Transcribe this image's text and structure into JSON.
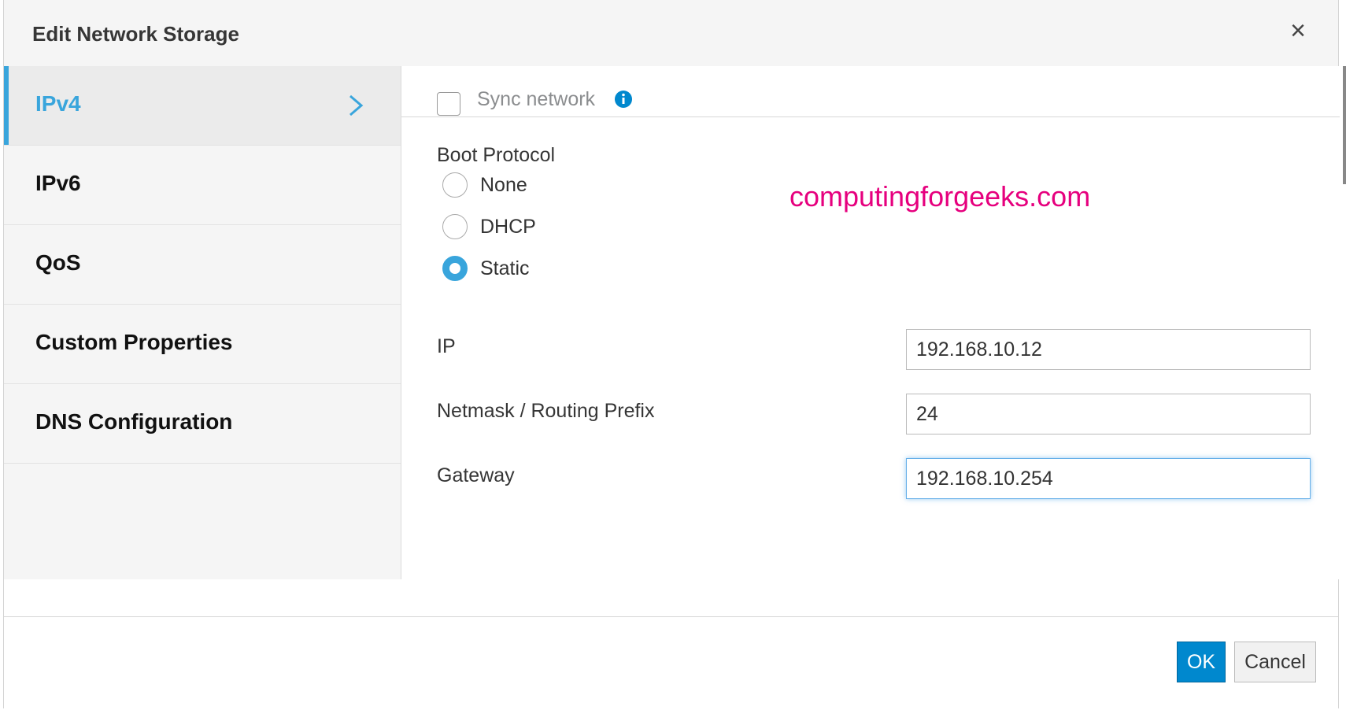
{
  "dialog": {
    "title": "Edit Network Storage",
    "close_glyph": "×"
  },
  "sidebar": {
    "items": [
      {
        "label": "IPv4",
        "active": true
      },
      {
        "label": "IPv6",
        "active": false
      },
      {
        "label": "QoS",
        "active": false
      },
      {
        "label": "Custom Properties",
        "active": false
      },
      {
        "label": "DNS Configuration",
        "active": false
      }
    ]
  },
  "content": {
    "sync_network": {
      "label": "Sync network",
      "checked": false,
      "icon": "info-icon"
    },
    "boot_protocol": {
      "label": "Boot Protocol",
      "options": [
        {
          "label": "None",
          "selected": false
        },
        {
          "label": "DHCP",
          "selected": false
        },
        {
          "label": "Static",
          "selected": true
        }
      ]
    },
    "ip": {
      "label": "IP",
      "value": "192.168.10.12"
    },
    "netmask": {
      "label": "Netmask / Routing Prefix",
      "value": "24"
    },
    "gateway": {
      "label": "Gateway",
      "value": "192.168.10.254"
    },
    "watermark": "computingforgeeks.com"
  },
  "footer": {
    "ok_label": "OK",
    "cancel_label": "Cancel"
  },
  "colors": {
    "accent": "#39a5dc",
    "primary_button": "#0088ce",
    "watermark": "#e6007e"
  }
}
